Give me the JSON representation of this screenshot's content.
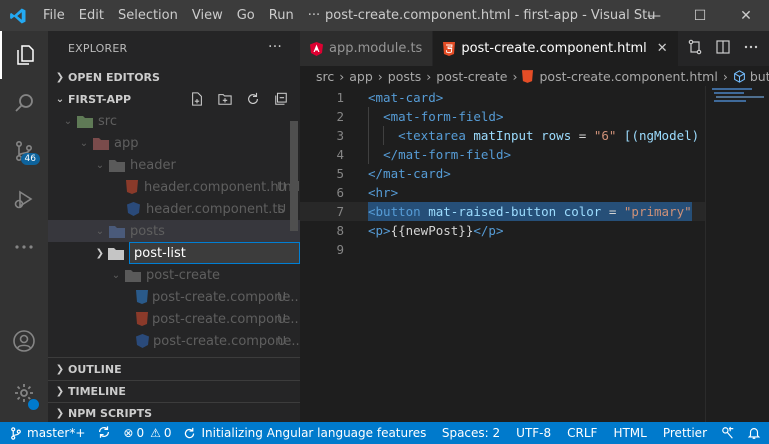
{
  "titlebar": {
    "menus": [
      "File",
      "Edit",
      "Selection",
      "View",
      "Go",
      "Run",
      "···"
    ],
    "title": "post-create.component.html - first-app - Visual Studio Code",
    "minimize": "—",
    "maximize": "☐",
    "close": "✕"
  },
  "activitybar": {
    "scm_badge": "46",
    "icons": [
      "explorer-icon",
      "search-icon",
      "source-control-icon",
      "run-debug-icon",
      "more-icon",
      "account-icon",
      "settings-icon"
    ]
  },
  "explorer": {
    "header": "EXPLORER",
    "more": "···",
    "open_editors": "OPEN EDITORS",
    "project": "FIRST-APP",
    "tree": [
      {
        "label": "src",
        "depth": 1,
        "type": "folder",
        "status": ""
      },
      {
        "label": "app",
        "depth": 2,
        "type": "folder",
        "status": ""
      },
      {
        "label": "header",
        "depth": 3,
        "type": "folder-plain",
        "status": ""
      },
      {
        "label": "header.component.html",
        "depth": 4,
        "type": "html",
        "status": "U"
      },
      {
        "label": "header.component.ts",
        "depth": 4,
        "type": "ts",
        "status": "U"
      },
      {
        "label": "posts",
        "depth": 3,
        "type": "folder-open",
        "status": ""
      },
      {
        "label": "post-list",
        "depth": 4,
        "type": "input",
        "status": ""
      },
      {
        "label": "post-create",
        "depth": 4,
        "type": "folder-plain",
        "status": ""
      },
      {
        "label": "post-create.compone...",
        "depth": 5,
        "type": "css",
        "status": "U"
      },
      {
        "label": "post-create.compone...",
        "depth": 5,
        "type": "html",
        "status": "U"
      },
      {
        "label": "post-create.compone...",
        "depth": 5,
        "type": "ts",
        "status": "U"
      }
    ],
    "outline": "OUTLINE",
    "timeline": "TIMELINE",
    "npm_scripts": "NPM SCRIPTS"
  },
  "tabs": [
    {
      "label": "app.module.ts",
      "active": false,
      "icon": "angular-icon"
    },
    {
      "label": "post-create.component.html",
      "active": true,
      "icon": "html-icon"
    }
  ],
  "breadcrumb": [
    "src",
    "app",
    "posts",
    "post-create",
    "post-create.component.html",
    "button"
  ],
  "code_lines": [
    {
      "n": "1",
      "tokens": [
        [
          "t-tag",
          "<mat-card>"
        ]
      ]
    },
    {
      "n": "2",
      "tokens": [
        [
          "t-text",
          "  "
        ],
        [
          "t-tag",
          "<mat-form-field>"
        ]
      ]
    },
    {
      "n": "3",
      "tokens": [
        [
          "t-text",
          "    "
        ],
        [
          "t-tag",
          "<textarea"
        ],
        [
          "t-text",
          " "
        ],
        [
          "t-attr",
          "matInput"
        ],
        [
          "t-text",
          " "
        ],
        [
          "t-attr",
          "rows"
        ],
        [
          "t-text",
          " = "
        ],
        [
          "t-str",
          "\"6\""
        ],
        [
          "t-text",
          " "
        ],
        [
          "t-attr",
          "[(ngModel)"
        ]
      ]
    },
    {
      "n": "4",
      "tokens": [
        [
          "t-text",
          "  "
        ],
        [
          "t-tag",
          "</mat-form-field>"
        ]
      ]
    },
    {
      "n": "5",
      "tokens": [
        [
          "t-tag",
          "</mat-card>"
        ]
      ]
    },
    {
      "n": "6",
      "tokens": [
        [
          "t-tag",
          "<hr>"
        ]
      ]
    },
    {
      "n": "7",
      "tokens": [
        [
          "t-tag",
          "<button"
        ],
        [
          "t-text",
          " "
        ],
        [
          "t-attr",
          "mat-raised-button"
        ],
        [
          "t-text",
          " "
        ],
        [
          "t-attr",
          "color"
        ],
        [
          "t-text",
          " = "
        ],
        [
          "t-str",
          "\"primary\""
        ]
      ]
    },
    {
      "n": "8",
      "tokens": [
        [
          "t-tag",
          "<p>"
        ],
        [
          "t-text",
          "{{newPost}}"
        ],
        [
          "t-tag",
          "</p>"
        ]
      ]
    },
    {
      "n": "9",
      "tokens": []
    }
  ],
  "statusbar": {
    "branch": "master*+",
    "errors": "0",
    "warnings": "0",
    "task": "Initializing Angular language features",
    "spaces": "Spaces: 2",
    "encoding": "UTF-8",
    "eol": "CRLF",
    "language": "HTML",
    "formatter": "Prettier"
  },
  "colors": {
    "accent": "#007acc",
    "html": "#e44d26",
    "angular": "#dd0031",
    "ts": "#3178c6",
    "css": "#42a5f5"
  }
}
